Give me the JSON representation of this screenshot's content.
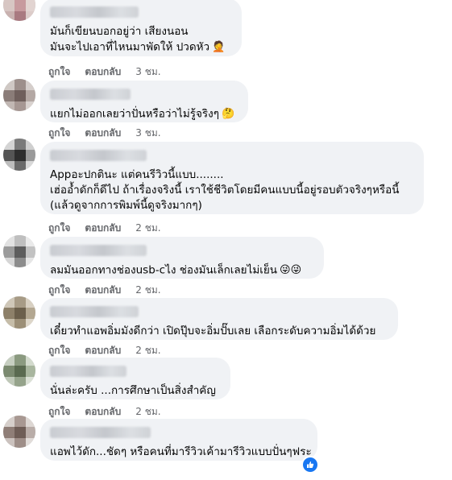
{
  "comments": [
    {
      "lines": [
        "มันก็เขียนบอกอยู่ว่า เสียงนอน",
        "มันจะไปเอาที่ไหนมาพัดให้ ปวดหัว"
      ],
      "emoji": "🤦",
      "like": "ถูกใจ",
      "reply": "ตอบกลับ",
      "time": "3 ชม."
    },
    {
      "lines": [
        "แยกไม่ออกเลยว่าปั่นหรือว่าไม่รู้จริงๆ"
      ],
      "emoji": "🤔",
      "like": "ถูกใจ",
      "reply": "ตอบกลับ",
      "time": "3 ชม."
    },
    {
      "lines": [
        "Appอะปกตินะ แต่คนรีวิวนี้แบบ........",
        "เฮ่ออ้ำดักก็ดีไป ถ้าเรื่องจริงนี้ เราใช้ชีวิตโดยมีคนแบบนี้อยู่รอบตัวจริงๆหรือนี้",
        "(แล้วดูจากการพิมพ์นี้ดูจริงมากๆ)"
      ],
      "emoji": "",
      "like": "ถูกใจ",
      "reply": "ตอบกลับ",
      "time": "2 ชม."
    },
    {
      "lines": [
        "ลมมันออกทางช่องusb-cไง ช่องมันเล็กเลยไม่เย็น"
      ],
      "emoji": "😜😜",
      "like": "ถูกใจ",
      "reply": "ตอบกลับ",
      "time": "2 ชม."
    },
    {
      "lines": [
        "เดี๋ยวทำแอพอิ่มมังดีกว่า เปิดปุ๊บจะอิ่มปั๊บเลย เลือกระดับความอิ่มได้ด้วย"
      ],
      "emoji": "",
      "like": "ถูกใจ",
      "reply": "ตอบกลับ",
      "time": "2 ชม."
    },
    {
      "lines": [
        "นั่นล่ะครับ ...การศึกษาเป็นสิ่งสำคัญ"
      ],
      "emoji": "",
      "like": "ถูกใจ",
      "reply": "ตอบกลับ",
      "time": "2 ชม."
    },
    {
      "lines": [
        "แอพไว้ดัก...ชัดๆ หรือคนที่มารีวิวเค้ามารีวิวแบบปั่นๆฟระ"
      ],
      "emoji": "",
      "like": "",
      "reply": "",
      "time": ""
    }
  ],
  "colors": {
    "bubble": "#f0f2f5",
    "meta": "#65676b",
    "like_badge": "#1877f2"
  },
  "icons": {
    "like_badge": "thumbs-up-icon"
  }
}
